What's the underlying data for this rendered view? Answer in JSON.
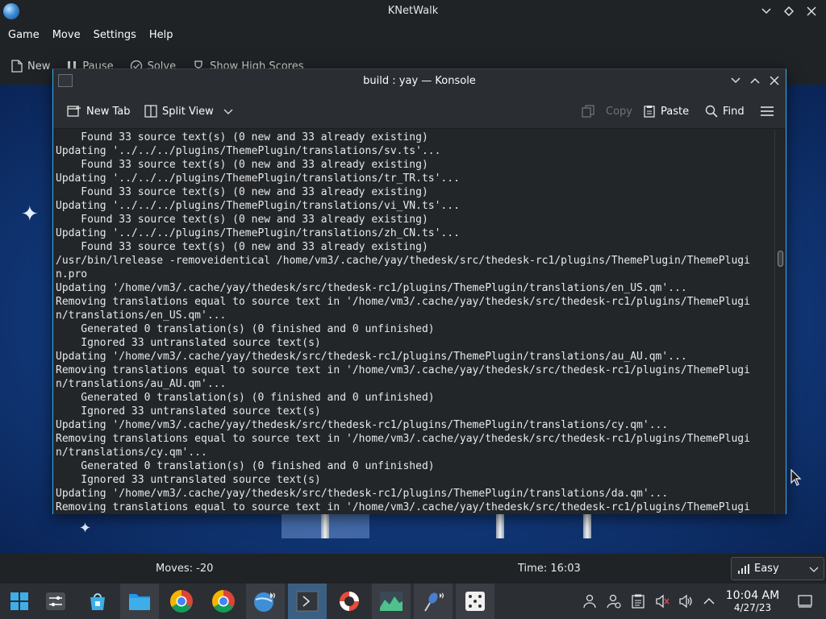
{
  "knetwalk": {
    "title": "KNetWalk",
    "menu": [
      "Game",
      "Move",
      "Settings",
      "Help"
    ],
    "toolbar": {
      "new": "New",
      "pause": "Pause",
      "solve": "Solve",
      "high_scores": "Show High Scores"
    },
    "status": {
      "moves": "Moves: -20",
      "time": "Time: 16:03",
      "difficulty": "Easy"
    }
  },
  "konsole": {
    "title": "build : yay — Konsole",
    "toolbar": {
      "new_tab": "New Tab",
      "split_view": "Split View",
      "copy": "Copy",
      "paste": "Paste",
      "find": "Find"
    },
    "lines": [
      "    Found 33 source text(s) (0 new and 33 already existing)",
      "Updating '../../../plugins/ThemePlugin/translations/sv.ts'...",
      "    Found 33 source text(s) (0 new and 33 already existing)",
      "Updating '../../../plugins/ThemePlugin/translations/tr_TR.ts'...",
      "    Found 33 source text(s) (0 new and 33 already existing)",
      "Updating '../../../plugins/ThemePlugin/translations/vi_VN.ts'...",
      "    Found 33 source text(s) (0 new and 33 already existing)",
      "Updating '../../../plugins/ThemePlugin/translations/zh_CN.ts'...",
      "    Found 33 source text(s) (0 new and 33 already existing)",
      "/usr/bin/lrelease -removeidentical /home/vm3/.cache/yay/thedesk/src/thedesk-rc1/plugins/ThemePlugin/ThemePlugi",
      "n.pro",
      "Updating '/home/vm3/.cache/yay/thedesk/src/thedesk-rc1/plugins/ThemePlugin/translations/en_US.qm'...",
      "Removing translations equal to source text in '/home/vm3/.cache/yay/thedesk/src/thedesk-rc1/plugins/ThemePlugi",
      "n/translations/en_US.qm'...",
      "    Generated 0 translation(s) (0 finished and 0 unfinished)",
      "    Ignored 33 untranslated source text(s)",
      "Updating '/home/vm3/.cache/yay/thedesk/src/thedesk-rc1/plugins/ThemePlugin/translations/au_AU.qm'...",
      "Removing translations equal to source text in '/home/vm3/.cache/yay/thedesk/src/thedesk-rc1/plugins/ThemePlugi",
      "n/translations/au_AU.qm'...",
      "    Generated 0 translation(s) (0 finished and 0 unfinished)",
      "    Ignored 33 untranslated source text(s)",
      "Updating '/home/vm3/.cache/yay/thedesk/src/thedesk-rc1/plugins/ThemePlugin/translations/cy.qm'...",
      "Removing translations equal to source text in '/home/vm3/.cache/yay/thedesk/src/thedesk-rc1/plugins/ThemePlugi",
      "n/translations/cy.qm'...",
      "    Generated 0 translation(s) (0 finished and 0 unfinished)",
      "    Ignored 33 untranslated source text(s)",
      "Updating '/home/vm3/.cache/yay/thedesk/src/thedesk-rc1/plugins/ThemePlugin/translations/da.qm'...",
      "Removing translations equal to source text in '/home/vm3/.cache/yay/thedesk/src/thedesk-rc1/plugins/ThemePlugi"
    ]
  },
  "taskbar": {
    "clock": {
      "time": "10:04 AM",
      "date": "4/27/23"
    }
  },
  "colors": {
    "accent": "#3daee9",
    "task_active": "#3b5f82",
    "terminal_bg": "#232629"
  }
}
